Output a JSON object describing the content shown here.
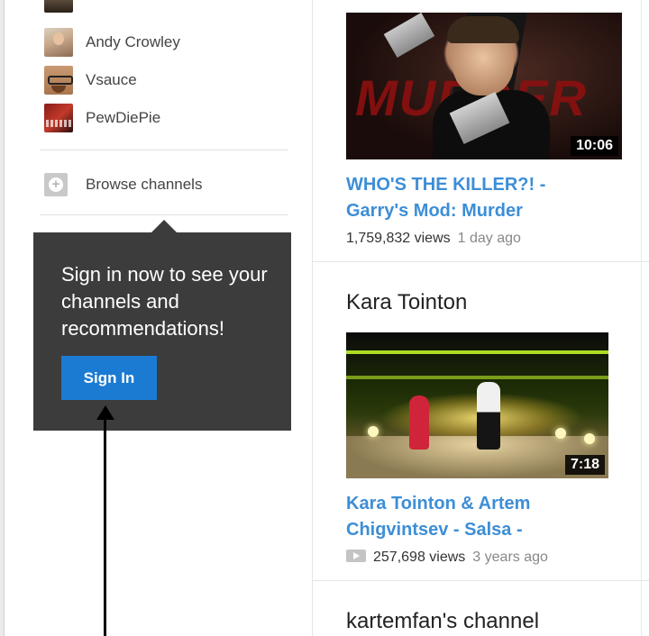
{
  "sidebar": {
    "channels": [
      {
        "name": "Andy Crowley",
        "avatar": "andy-crowley-avatar"
      },
      {
        "name": "Vsauce",
        "avatar": "vsauce-avatar"
      },
      {
        "name": "PewDiePie",
        "avatar": "pewdiepie-avatar"
      }
    ],
    "browse_channels": {
      "label": "Browse channels",
      "icon": "plus-icon"
    }
  },
  "signin_tooltip": {
    "message": "Sign in now to see your channels and recommendations!",
    "button_label": "Sign In",
    "background": "#3c3c3c",
    "button_color": "#1b7bd3"
  },
  "annotation": {
    "icon": "arrow-up-icon"
  },
  "feed": {
    "video1": {
      "title": "WHO'S THE KILLER?! - Garry's Mod: Murder",
      "duration": "10:06",
      "views": "1,759,832 views",
      "ago": "1 day ago",
      "thumb_text": "MURDER"
    },
    "section2": {
      "title": "Kara Tointon",
      "video": {
        "title": "Kara Tointon & Artem Chigvintsev - Salsa -",
        "duration": "7:18",
        "views": "257,698 views",
        "ago": "3 years ago"
      }
    },
    "section3": {
      "title": "kartemfan's channel"
    }
  },
  "colors": {
    "link": "#3d8ed6",
    "accent": "#1b7bd3"
  }
}
